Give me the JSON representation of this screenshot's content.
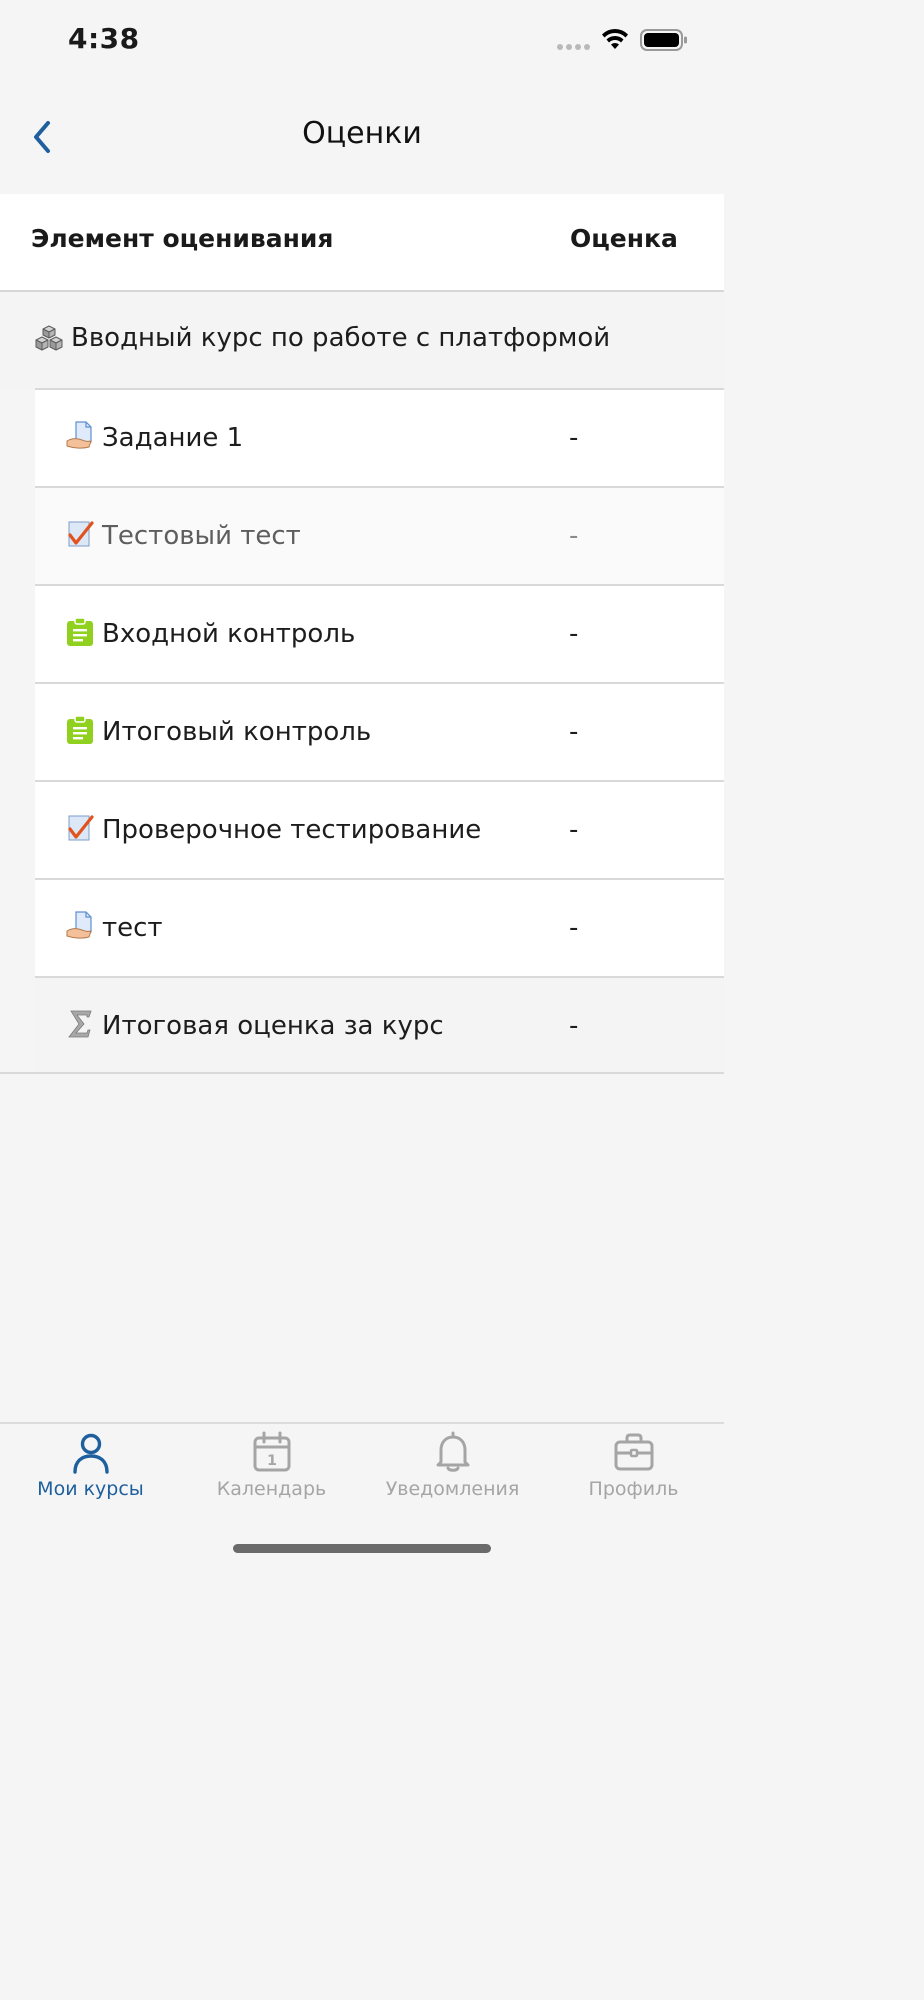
{
  "status_bar": {
    "time": "4:38"
  },
  "nav": {
    "title": "Оценки",
    "back_icon": "chevron-left-icon"
  },
  "table": {
    "col_item": "Элемент оценивания",
    "col_grade": "Оценка"
  },
  "category": {
    "label": "Вводный курс по работе с платформой",
    "icon": "cubes-icon"
  },
  "items": [
    {
      "label": "Задание 1",
      "grade": "-",
      "icon": "assignment-icon"
    },
    {
      "label": "Тестовый тест",
      "grade": "-",
      "icon": "quiz-icon"
    },
    {
      "label": "Входной контроль",
      "grade": "-",
      "icon": "clipboard-icon"
    },
    {
      "label": "Итоговый контроль",
      "grade": "-",
      "icon": "clipboard-icon"
    },
    {
      "label": "Проверочное тестирование",
      "grade": "-",
      "icon": "quiz-icon"
    },
    {
      "label": "тест",
      "grade": "-",
      "icon": "assignment-icon"
    }
  ],
  "course_total": {
    "label": "Итоговая оценка за курс",
    "grade": "-",
    "icon": "sigma-icon"
  },
  "tabs": [
    {
      "label": "Мои курсы",
      "icon": "user-icon",
      "active": true
    },
    {
      "label": "Календарь",
      "icon": "calendar-icon",
      "active": false
    },
    {
      "label": "Уведомления",
      "icon": "bell-icon",
      "active": false
    },
    {
      "label": "Профиль",
      "icon": "briefcase-icon",
      "active": false
    }
  ],
  "colors": {
    "accent": "#1e5f9e",
    "inactive": "#a5a5a5",
    "clipboard": "#8fd11e",
    "quiz_check": "#e0531e"
  }
}
